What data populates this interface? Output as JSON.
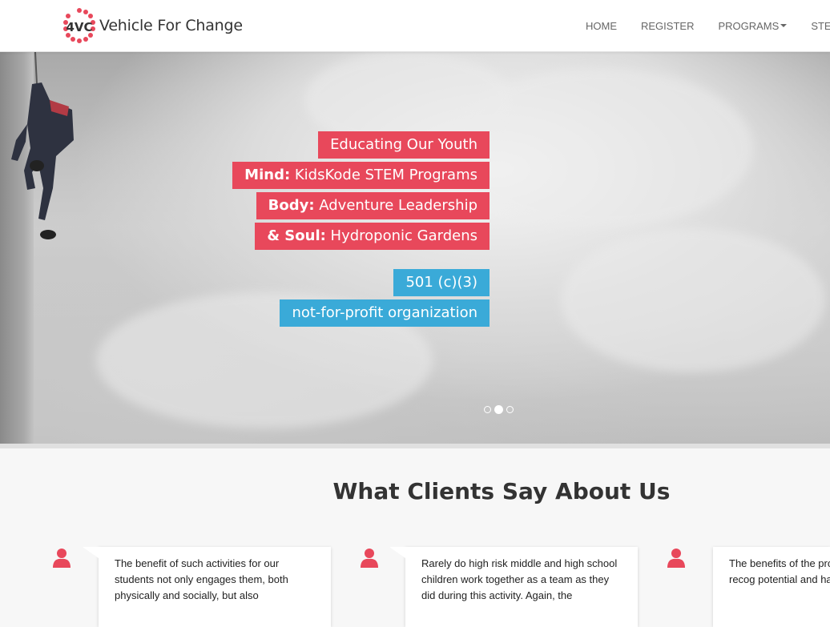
{
  "brand": {
    "logo_text": "4VC",
    "name": "Vehicle For Change"
  },
  "nav": {
    "items": [
      {
        "label": "HOME",
        "dropdown": false
      },
      {
        "label": "REGISTER",
        "dropdown": false
      },
      {
        "label": "PROGRAMS",
        "dropdown": true
      },
      {
        "label": "STEM",
        "dropdown": true
      }
    ]
  },
  "hero": {
    "line1": "Educating Our Youth",
    "line2_bold": "Mind:",
    "line2_text": " KidsKode STEM Programs",
    "line3_bold": "Body:",
    "line3_text": " Adventure Leadership",
    "line4_bold": "& Soul:",
    "line4_text": " Hydroponic Gardens",
    "line5": "501 (c)(3)",
    "line6": "not-for-profit organization",
    "slides_total": 3,
    "active_slide": 2
  },
  "testimonials": {
    "title": "What Clients Say About Us",
    "items": [
      {
        "text": "The benefit of such activities for our students not only engages them, both physically and socially, but also"
      },
      {
        "text": "Rarely do high risk middle and high school children work together as a team as they did during this activity. Again, the"
      },
      {
        "text": "The benefits of the pro young people to recog potential and have the"
      }
    ]
  },
  "colors": {
    "accent_red": "#e8485b",
    "accent_blue": "#3aaad8",
    "user_icon": "#e8485b"
  }
}
